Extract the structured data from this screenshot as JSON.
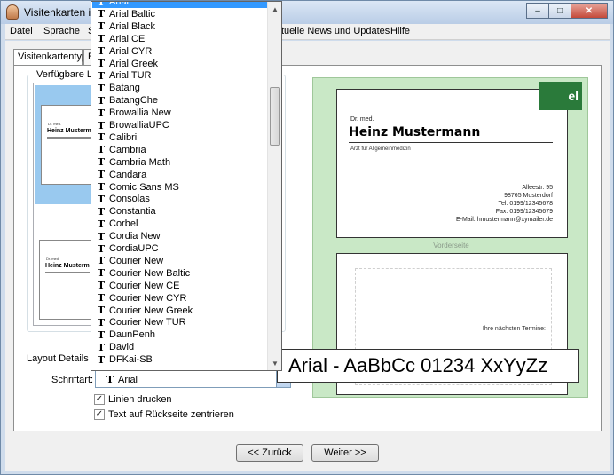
{
  "window": {
    "title": "Visitenkarten in",
    "buttons": {
      "minimize": "–",
      "maximize": "□",
      "close": "✕"
    }
  },
  "menu": {
    "items": [
      "Datei",
      "Sprache",
      "S",
      "tuelle News und Updates",
      "Hilfe"
    ]
  },
  "tabs": [
    "Visitenkartentyp",
    "E"
  ],
  "layouts": {
    "group_label": "Verfügbare Layou",
    "thumb1": {
      "title": "Dr. med.",
      "name": "Heinz Musterm"
    },
    "thumb2": {
      "title": "Dr. med.",
      "name": "Heinz Musterm"
    }
  },
  "details": {
    "group_label": "Layout Details",
    "font_label": "Schriftart:",
    "font_value": "Arial",
    "check_lines": {
      "label": "Linien drucken",
      "checked": true
    },
    "check_center": {
      "label": "Text auf Rückseite zentrieren",
      "checked": true
    }
  },
  "font_dropdown": {
    "selected": "Arial",
    "items": [
      "Arial",
      "Arial Baltic",
      "Arial Black",
      "Arial CE",
      "Arial CYR",
      "Arial Greek",
      "Arial TUR",
      "Batang",
      "BatangChe",
      "Browallia New",
      "BrowalliaUPC",
      "Calibri",
      "Cambria",
      "Cambria Math",
      "Candara",
      "Comic Sans MS",
      "Consolas",
      "Constantia",
      "Corbel",
      "Cordia New",
      "CordiaUPC",
      "Courier New",
      "Courier New Baltic",
      "Courier New CE",
      "Courier New CYR",
      "Courier New Greek",
      "Courier New TUR",
      "DaunPenh",
      "David",
      "DFKai-SB"
    ],
    "scroll": {
      "up": "▲",
      "down": "▼"
    }
  },
  "preview": {
    "front": {
      "logo": "el",
      "title": "Dr. med.",
      "name": "Heinz Mustermann",
      "subtitle": "Arzt für Allgemeinmedizin",
      "address": [
        "Alleestr. 95",
        "98765 Musterdorf",
        "Tel: 0199/12345678",
        "Fax: 0199/12345679",
        "E-Mail: hmustermann@xymailer.de"
      ]
    },
    "front_label": "Vorderseite",
    "back": {
      "text": "Ihre nächsten Termine:"
    }
  },
  "sample_text": "Arial - AaBbCc 01234 XxYyZz",
  "nav": {
    "back": "<< Zurück",
    "next": "Weiter >>"
  },
  "colors": {
    "selection": "#3399ff",
    "preview_bg": "#c9e8c6",
    "logo": "#2a7a3a"
  }
}
